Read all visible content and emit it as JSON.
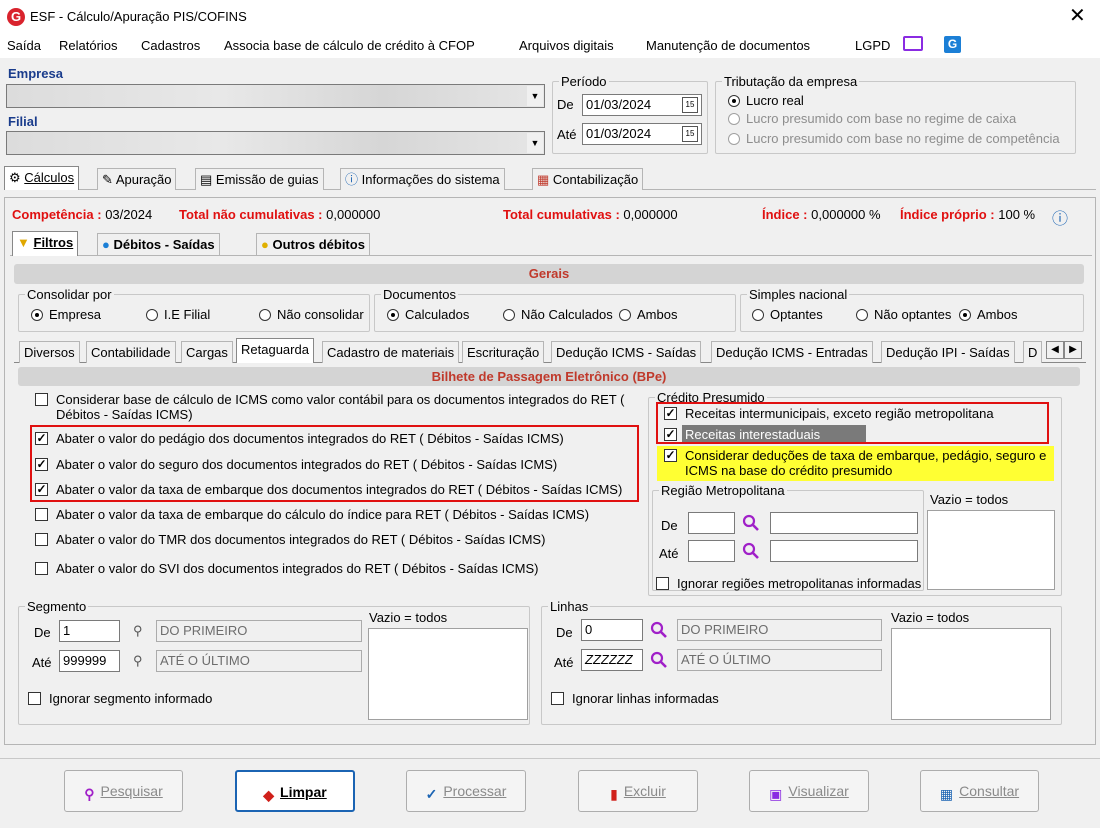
{
  "window": {
    "title": "ESF - Cálculo/Apuração PIS/COFINS",
    "close": "✕"
  },
  "menu": [
    "Saída",
    "Relatórios",
    "Cadastros",
    "Associa base de cálculo de crédito à CFOP",
    "Arquivos digitais",
    "Manutenção de documentos",
    "LGPD"
  ],
  "empresa": {
    "label": "Empresa",
    "value": ""
  },
  "filial": {
    "label": "Filial",
    "value": ""
  },
  "periodo": {
    "label": "Período",
    "de_label": "De",
    "de": "01/03/2024",
    "ate_label": "Até",
    "ate": "01/03/2024"
  },
  "tributacao": {
    "label": "Tributação da empresa",
    "options": [
      "Lucro real",
      "Lucro presumido com base no regime de caixa",
      "Lucro presumido com base no regime de competência"
    ],
    "selected": 0
  },
  "main_tabs": [
    "Cálculos",
    "Apuração",
    "Emissão de guias",
    "Informações do sistema",
    "Contabilização"
  ],
  "status": {
    "competencia_label": "Competência :",
    "competencia": "03/2024",
    "nao_cum_label": "Total não cumulativas :",
    "nao_cum": "0,000000",
    "cum_label": "Total cumulativas :",
    "cum": "0,000000",
    "indice_label": "Índice :",
    "indice": "0,000000 %",
    "indice_proprio_label": "Índice próprio :",
    "indice_proprio": "100 %"
  },
  "sub_tabs": [
    "Filtros",
    "Débitos - Saídas",
    "Outros débitos"
  ],
  "gerais": {
    "title": "Gerais",
    "consolidar": {
      "label": "Consolidar por",
      "options": [
        "Empresa",
        "I.E Filial",
        "Não consolidar"
      ],
      "selected": 0
    },
    "documentos": {
      "label": "Documentos",
      "options": [
        "Calculados",
        "Não Calculados",
        "Ambos"
      ],
      "selected": 0
    },
    "simples": {
      "label": "Simples nacional",
      "options": [
        "Optantes",
        "Não optantes",
        "Ambos"
      ],
      "selected": 2
    }
  },
  "filter_tabs": [
    "Diversos",
    "Contabilidade",
    "Cargas",
    "Retaguarda",
    "Cadastro de materiais",
    "Escrituração",
    "Dedução ICMS - Saídas",
    "Dedução ICMS - Entradas",
    "Dedução IPI - Saídas",
    "D"
  ],
  "bpe": {
    "title": "Bilhete de Passagem Eletrônico (BPe)",
    "checks": [
      {
        "text": "Considerar base de cálculo de ICMS como valor contábil para os documentos integrados do RET ( Débitos - Saídas ICMS)",
        "checked": false
      },
      {
        "text": "Abater o valor do pedágio dos documentos integrados do RET ( Débitos - Saídas ICMS)",
        "checked": true
      },
      {
        "text": "Abater o valor do seguro dos documentos integrados do RET ( Débitos - Saídas ICMS)",
        "checked": true
      },
      {
        "text": "Abater o valor da taxa de embarque dos documentos integrados do RET ( Débitos - Saídas ICMS)",
        "checked": true
      },
      {
        "text": "Abater o valor da taxa de embarque do cálculo do índice para RET ( Débitos - Saídas ICMS)",
        "checked": false
      },
      {
        "text": "Abater o valor do TMR dos documentos integrados do RET ( Débitos - Saídas ICMS)",
        "checked": false
      },
      {
        "text": "Abater o valor do SVI dos documentos integrados do RET ( Débitos - Saídas ICMS)",
        "checked": false
      }
    ],
    "credito": {
      "label": "Crédito Presumido",
      "items": [
        {
          "text": "Receitas intermunicipais, exceto região metropolitana",
          "checked": true
        },
        {
          "text": "Receitas interestaduais",
          "checked": true
        },
        {
          "text": "Considerar deduções de taxa de embarque, pedágio, seguro e ICMS na base do crédito presumido",
          "checked": true
        }
      ]
    },
    "regiao": {
      "label": "Região Metropolitana",
      "de": "De",
      "ate": "Até",
      "vazio": "Vazio = todos",
      "ignorar": "Ignorar regiões metropolitanas informadas"
    }
  },
  "segmento": {
    "label": "Segmento",
    "de_label": "De",
    "de": "1",
    "de_desc": "DO PRIMEIRO",
    "ate_label": "Até",
    "ate": "999999",
    "ate_desc": "ATÉ O ÚLTIMO",
    "vazio": "Vazio = todos",
    "ignorar": "Ignorar segmento informado"
  },
  "linhas": {
    "label": "Linhas",
    "de_label": "De",
    "de": "0",
    "de_desc": "DO PRIMEIRO",
    "ate_label": "Até",
    "ate": "ZZZZZZ",
    "ate_desc": "ATÉ O ÚLTIMO",
    "vazio": "Vazio = todos",
    "ignorar": "Ignorar linhas informadas"
  },
  "buttons": [
    "Pesquisar",
    "Limpar",
    "Processar",
    "Excluir",
    "Visualizar",
    "Consultar"
  ]
}
